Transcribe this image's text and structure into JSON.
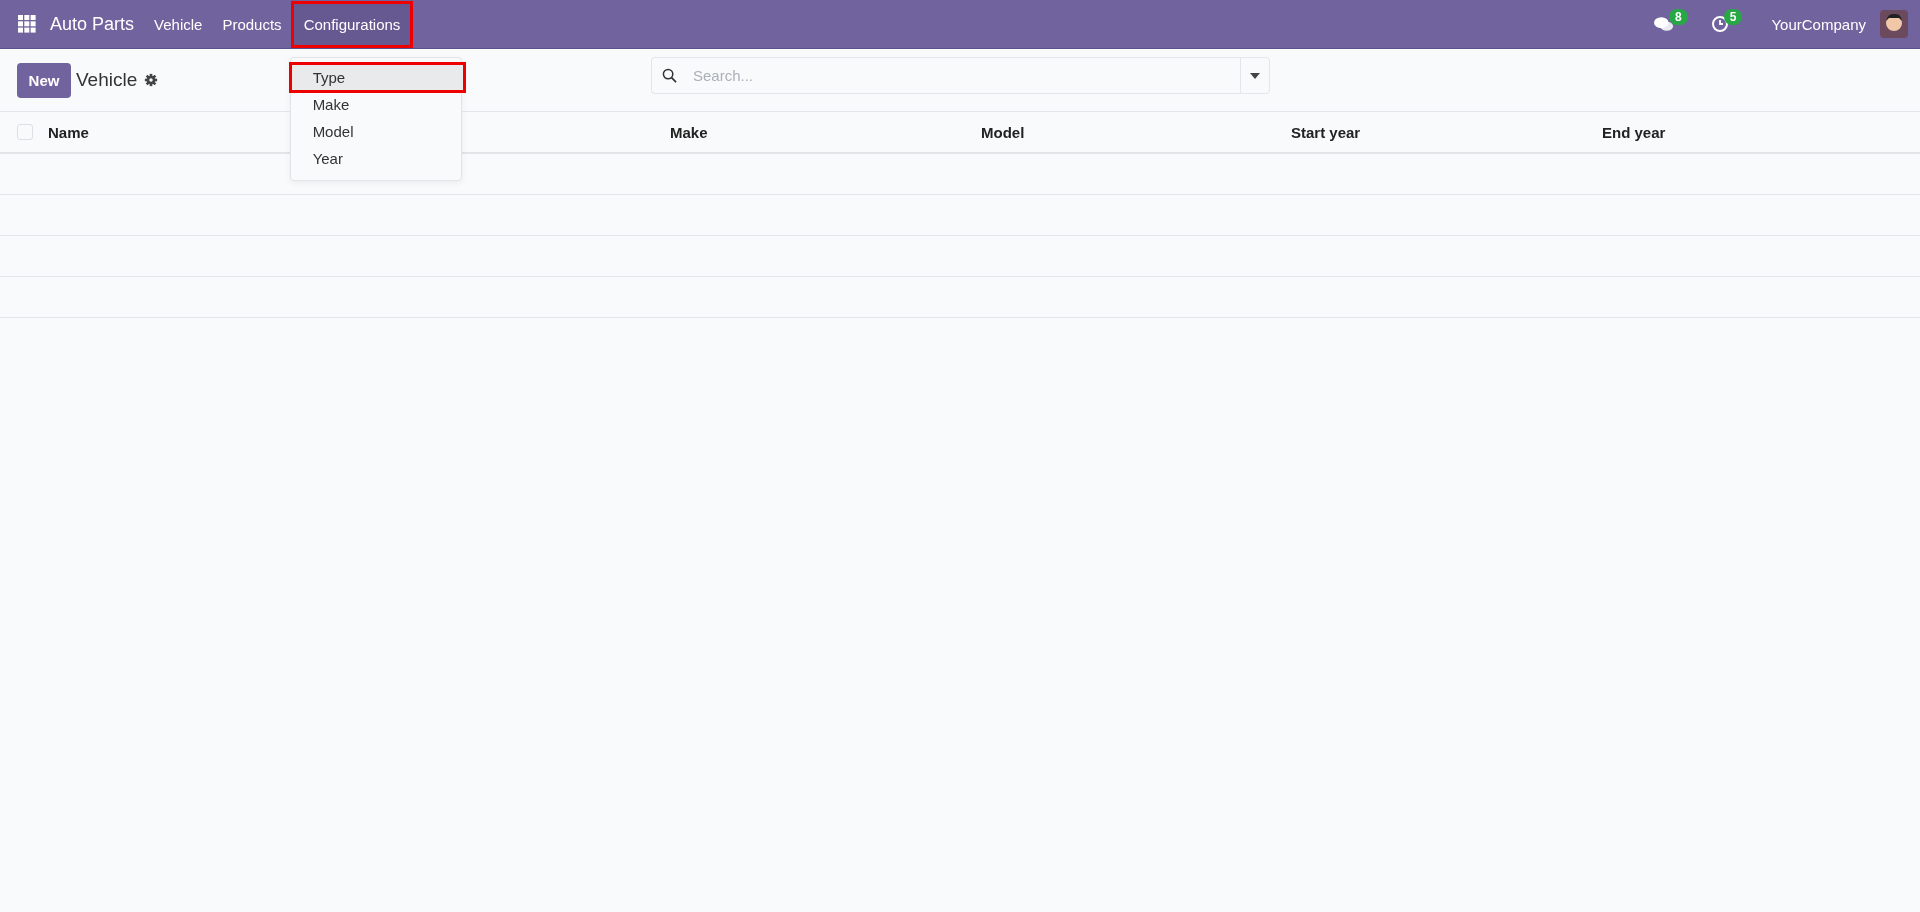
{
  "navbar": {
    "app_name": "Auto Parts",
    "menu": [
      {
        "label": "Vehicle",
        "selected": false,
        "highlighted": false
      },
      {
        "label": "Products",
        "selected": false,
        "highlighted": false
      },
      {
        "label": "Configurations",
        "selected": true,
        "highlighted": true
      }
    ],
    "messages_badge": "8",
    "activities_badge": "5",
    "company": "YourCompany"
  },
  "dropdown": {
    "items": [
      {
        "label": "Type",
        "selected": true,
        "highlighted": true
      },
      {
        "label": "Make",
        "selected": false,
        "highlighted": false
      },
      {
        "label": "Model",
        "selected": false,
        "highlighted": false
      },
      {
        "label": "Year",
        "selected": false,
        "highlighted": false
      }
    ]
  },
  "control_panel": {
    "new_button": "New",
    "title": "Vehicle"
  },
  "search": {
    "placeholder": "Search..."
  },
  "table": {
    "select_all_checked": false,
    "columns": [
      "Name",
      "Make",
      "Model",
      "Start year",
      "End year"
    ]
  }
}
